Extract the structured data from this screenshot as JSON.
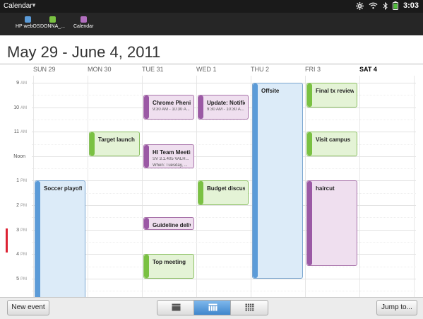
{
  "status_bar": {
    "app_title": "Calendar",
    "time": "3:03",
    "icons": [
      "settings-icon",
      "wifi-icon",
      "bluetooth-icon",
      "battery-icon"
    ]
  },
  "calendars": [
    {
      "label": "HP webOS",
      "color": "#5b9bd8"
    },
    {
      "label": "DONNA_...",
      "color": "#7ac142"
    },
    {
      "label": "Calendar",
      "color": "#b26fbf"
    }
  ],
  "header": {
    "date_range": "May 29 - June 4, 2011"
  },
  "days": [
    "SUN 29",
    "MON 30",
    "TUE 31",
    "WED 1",
    "THU 2",
    "FRI 3",
    "SAT 4"
  ],
  "today": "SAT 4",
  "hours": [
    {
      "num": "9",
      "ampm": "AM"
    },
    {
      "num": "10",
      "ampm": "AM"
    },
    {
      "num": "11",
      "ampm": "AM"
    },
    {
      "num": "Noon",
      "ampm": ""
    },
    {
      "num": "1",
      "ampm": "PM"
    },
    {
      "num": "2",
      "ampm": "PM"
    },
    {
      "num": "3",
      "ampm": "PM"
    },
    {
      "num": "4",
      "ampm": "PM"
    },
    {
      "num": "5",
      "ampm": "PM"
    }
  ],
  "events": [
    {
      "title": "Chrome Phenify...",
      "details": [
        "9:30 AM - 10:30 A..."
      ],
      "day": 2,
      "start": 9.5,
      "end": 10.5,
      "calendar": "purple"
    },
    {
      "title": "Update: Notific...",
      "details": [
        "9:30 AM - 10:30 A..."
      ],
      "day": 3,
      "start": 9.5,
      "end": 10.5,
      "calendar": "purple"
    },
    {
      "title": "Offsite",
      "details": [],
      "day": 4,
      "start": 9.0,
      "end": 17.0,
      "calendar": "blue"
    },
    {
      "title": "Final tx review",
      "details": [],
      "day": 5,
      "start": 9.0,
      "end": 10.0,
      "calendar": "green"
    },
    {
      "title": "Target launch",
      "details": [],
      "day": 1,
      "start": 11.0,
      "end": 12.0,
      "calendar": "green"
    },
    {
      "title": "Visit campus",
      "details": [],
      "day": 5,
      "start": 11.0,
      "end": 12.0,
      "calendar": "green"
    },
    {
      "title": "HI Team Meeting",
      "details": [
        "SV 3.1.405 VALH...",
        "When: Tuesday, ..."
      ],
      "day": 2,
      "start": 11.5,
      "end": 12.5,
      "calendar": "purple"
    },
    {
      "title": "Soccer playoffs",
      "details": [],
      "day": 0,
      "start": 13.0,
      "end": 17.9,
      "calendar": "blue"
    },
    {
      "title": "Budget discuss...",
      "details": [],
      "day": 3,
      "start": 13.0,
      "end": 14.0,
      "calendar": "green"
    },
    {
      "title": "haircut",
      "details": [],
      "day": 5,
      "start": 13.0,
      "end": 16.5,
      "calendar": "purple"
    },
    {
      "title": "Guideline deliv...",
      "details": [],
      "day": 2,
      "start": 14.5,
      "end": 15.0,
      "calendar": "purple"
    },
    {
      "title": "Top meeting",
      "details": [],
      "day": 2,
      "start": 16.0,
      "end": 17.0,
      "calendar": "green"
    }
  ],
  "bottom_bar": {
    "new_event": "New event",
    "jump_to": "Jump to...",
    "view_modes": [
      "day-view-icon",
      "week-view-icon",
      "month-view-icon"
    ],
    "active_view": "week-view-icon"
  }
}
